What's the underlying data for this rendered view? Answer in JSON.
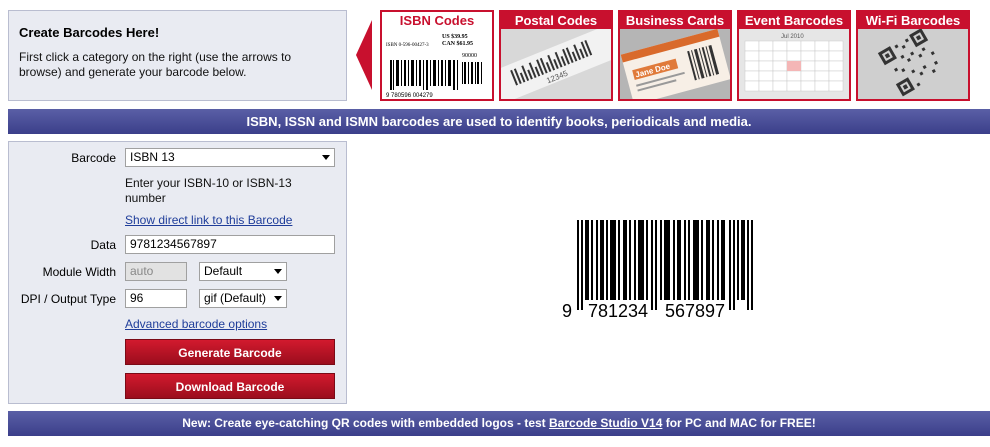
{
  "intro": {
    "title": "Create Barcodes Here!",
    "text": "First click a category on the right (use the arrows to browse) and generate your barcode below."
  },
  "categories": [
    {
      "label": "ISBN Codes",
      "selected": true
    },
    {
      "label": "Postal Codes",
      "selected": false
    },
    {
      "label": "Business Cards",
      "selected": false
    },
    {
      "label": "Event Barcodes",
      "selected": false
    },
    {
      "label": "Wi-Fi Barcodes",
      "selected": false
    }
  ],
  "thumbs": {
    "isbn_price_us": "US $39.95",
    "isbn_price_can": "CAN $61.95",
    "isbn_number": "ISBN 0-596-00427-3",
    "isbn_code": "90000",
    "isbn_digits": "9 780596 004279",
    "postal_number": "12345",
    "business_name": "Jane Doe",
    "event_month": "Jul 2010"
  },
  "banner_text": "ISBN, ISSN and ISMN barcodes are used to identify books, periodicals and media.",
  "form": {
    "barcode_label": "Barcode",
    "barcode_value": "ISBN 13",
    "hint": "Enter your ISBN-10 or ISBN-13 number",
    "direct_link": "Show direct link to this Barcode",
    "data_label": "Data",
    "data_value": "9781234567897",
    "module_width_label": "Module Width",
    "module_width_value": "auto",
    "module_width_option": "Default",
    "dpi_label": "DPI / Output Type",
    "dpi_value": "96",
    "output_type": "gif (Default)",
    "advanced_link": "Advanced barcode options",
    "generate_button": "Generate Barcode",
    "download_button": "Download Barcode"
  },
  "barcode": {
    "digit_first": "9",
    "digits_left": "781234",
    "digits_right": "567897"
  },
  "bottom": {
    "prefix": "New: Create eye-catching QR codes with embedded logos - test ",
    "link": "Barcode Studio V14",
    "suffix": " for PC and MAC for FREE!"
  }
}
